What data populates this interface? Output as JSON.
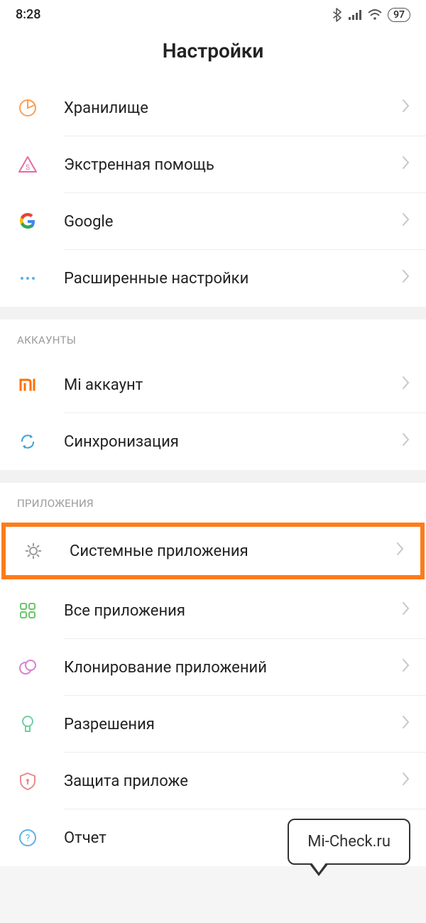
{
  "status": {
    "time": "8:28",
    "battery": "97"
  },
  "header": {
    "title": "Настройки"
  },
  "group1": {
    "items": [
      {
        "label": "Хранилище"
      },
      {
        "label": "Экстренная помощь"
      },
      {
        "label": "Google"
      },
      {
        "label": "Расширенные настройки"
      }
    ]
  },
  "group2": {
    "header": "АККАУНТЫ",
    "items": [
      {
        "label": "Mi аккаунт"
      },
      {
        "label": "Синхронизация"
      }
    ]
  },
  "group3": {
    "header": "ПРИЛОЖЕНИЯ",
    "items": [
      {
        "label": "Системные приложения"
      },
      {
        "label": "Все приложения"
      },
      {
        "label": "Клонирование приложений"
      },
      {
        "label": "Разрешения"
      },
      {
        "label": "Защита приложе"
      },
      {
        "label": "Отчет"
      }
    ]
  },
  "bubble": {
    "text": "Mi-Check.ru"
  }
}
